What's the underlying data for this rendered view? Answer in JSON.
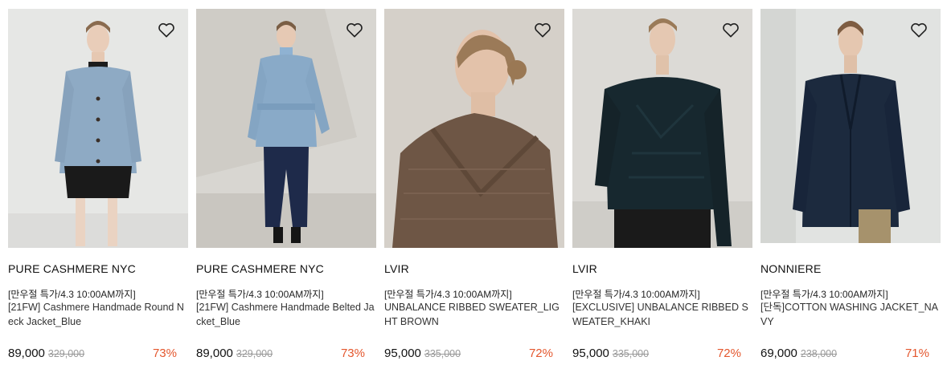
{
  "colors": {
    "discount": "#e4572e",
    "original_price": "#999999"
  },
  "products": [
    {
      "brand": "PURE CASHMERE NYC",
      "promo": "[만우절 특가/4.3 10:00AM까지]",
      "name": "[21FW] Cashmere Handmade Round Neck Jacket_Blue",
      "price": "89,000",
      "original_price": "329,000",
      "discount": "73%",
      "wishlist_icon": "heart-outline-icon"
    },
    {
      "brand": "PURE CASHMERE NYC",
      "promo": "[만우절 특가/4.3 10:00AM까지]",
      "name": "[21FW] Cashmere Handmade Belted Jacket_Blue",
      "price": "89,000",
      "original_price": "329,000",
      "discount": "73%",
      "wishlist_icon": "heart-outline-icon"
    },
    {
      "brand": "LVIR",
      "promo": "[만우절 특가/4.3 10:00AM까지]",
      "name": "UNBALANCE RIBBED SWEATER_LIGHT BROWN",
      "price": "95,000",
      "original_price": "335,000",
      "discount": "72%",
      "wishlist_icon": "heart-outline-icon"
    },
    {
      "brand": "LVIR",
      "promo": "[만우절 특가/4.3 10:00AM까지]",
      "name": "[EXCLUSIVE] UNBALANCE RIBBED SWEATER_KHAKI",
      "price": "95,000",
      "original_price": "335,000",
      "discount": "72%",
      "wishlist_icon": "heart-outline-icon"
    },
    {
      "brand": "NONNIERE",
      "promo": "[만우절 특가/4.3 10:00AM까지]",
      "name": "[단독]COTTON WASHING JACKET_NAVY",
      "price": "69,000",
      "original_price": "238,000",
      "discount": "71%",
      "wishlist_icon": "heart-outline-icon"
    }
  ]
}
